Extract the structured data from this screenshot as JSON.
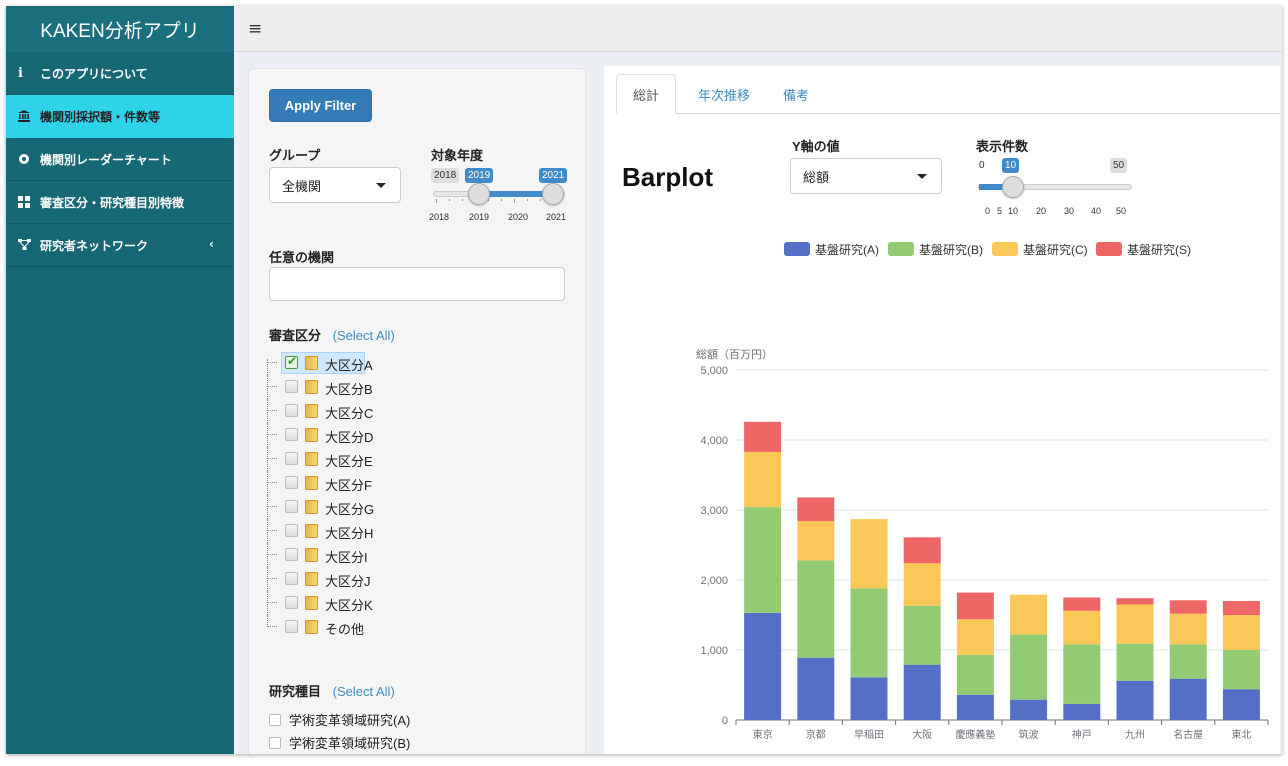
{
  "app": {
    "title": "KAKEN分析アプリ"
  },
  "topbar": {
    "menu_icon": "hamburger-icon"
  },
  "sidebar": {
    "items": [
      {
        "label": "このアプリについて",
        "icon": "info-icon",
        "active": false
      },
      {
        "label": "機関別採択額・件数等",
        "icon": "institution-icon",
        "active": true
      },
      {
        "label": "機関別レーダーチャート",
        "icon": "radar-dot-icon",
        "active": false
      },
      {
        "label": "審査区分・研究種目別特徴",
        "icon": "grid-icon",
        "active": false
      },
      {
        "label": "研究者ネットワーク",
        "icon": "network-icon",
        "active": false,
        "has_caret": true
      }
    ]
  },
  "filters": {
    "apply_label": "Apply Filter",
    "group_label": "グループ",
    "group_value": "全機関",
    "year_label": "対象年度",
    "year_slider": {
      "min_tag": "2018",
      "from_tag": "2019",
      "to_tag": "2021",
      "ticks": [
        "2018",
        "2019",
        "2020",
        "2021"
      ]
    },
    "institution_label": "任意の機関",
    "institution_value": "",
    "review_label": "審査区分",
    "select_all": "(Select All)",
    "review_items": [
      "大区分A",
      "大区分B",
      "大区分C",
      "大区分D",
      "大区分E",
      "大区分F",
      "大区分G",
      "大区分H",
      "大区分I",
      "大区分J",
      "大区分K",
      "その他"
    ],
    "research_label": "研究種目",
    "research_items": [
      "学術変革領域研究(A)",
      "学術変革領域研究(B)"
    ]
  },
  "tabs": [
    {
      "label": "総計",
      "active": true
    },
    {
      "label": "年次推移",
      "active": false
    },
    {
      "label": "備考",
      "active": false
    }
  ],
  "controls": {
    "y_label": "Y軸の値",
    "y_value": "総額",
    "count_label": "表示件数",
    "count_slider": {
      "min_tag": "0",
      "value_tag": "10",
      "max_tag": "50",
      "ticks": [
        "0",
        "5",
        "10",
        "20",
        "30",
        "40",
        "50"
      ]
    }
  },
  "barplot_title": "Barplot",
  "chart_data": {
    "type": "bar",
    "stacked": true,
    "ylabel": "総額（百万円）",
    "ylim": [
      0,
      5000
    ],
    "yticks": [
      "0",
      "1,000",
      "2,000",
      "3,000",
      "4,000",
      "5,000"
    ],
    "categories": [
      "東京",
      "京都",
      "早稲田",
      "大阪",
      "慶應義塾",
      "筑波",
      "神戸",
      "九州",
      "名古屋",
      "東北"
    ],
    "legend_position": "top",
    "series": [
      {
        "name": "基盤研究(A)",
        "color": "#5470c6",
        "values": [
          1530,
          890,
          610,
          790,
          360,
          290,
          230,
          560,
          590,
          440
        ]
      },
      {
        "name": "基盤研究(B)",
        "color": "#91cc75",
        "values": [
          1510,
          1390,
          1270,
          840,
          570,
          930,
          850,
          530,
          490,
          560
        ]
      },
      {
        "name": "基盤研究(C)",
        "color": "#fac858",
        "values": [
          790,
          560,
          990,
          610,
          510,
          570,
          480,
          560,
          440,
          500
        ]
      },
      {
        "name": "基盤研究(S)",
        "color": "#ee6666",
        "values": [
          430,
          340,
          0,
          370,
          380,
          0,
          190,
          90,
          190,
          200
        ]
      }
    ]
  }
}
